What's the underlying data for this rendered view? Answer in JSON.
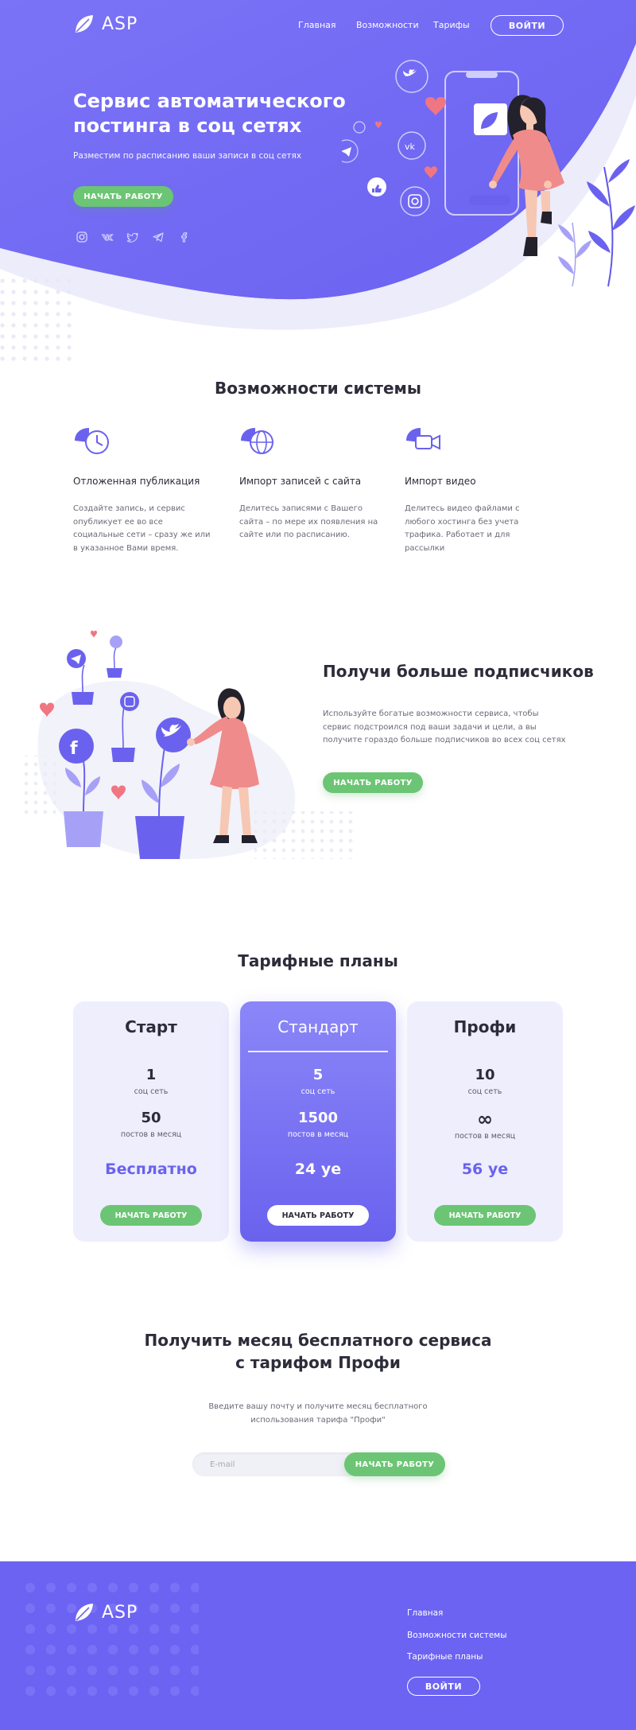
{
  "brand": {
    "name": "ASP"
  },
  "nav": {
    "items": [
      "Главная",
      "Возможности",
      "Тарифы"
    ],
    "login": "ВОЙТИ"
  },
  "hero": {
    "title": "Сервис автоматического постинга в соц сетях",
    "subtitle": "Разместим по расписанию ваши записи в соц сетях",
    "cta": "НАЧАТЬ РАБОТУ",
    "social_icons": [
      "instagram-icon",
      "vk-icon",
      "twitter-icon",
      "telegram-icon",
      "facebook-icon"
    ]
  },
  "features": {
    "title": "Возможности системы",
    "items": [
      {
        "icon": "clock-icon",
        "title": "Отложенная публикация",
        "text": "Создайте запись, и сервис опубликует ее во все социальные сети – сразу же или в указанное Вами время."
      },
      {
        "icon": "globe-icon",
        "title": "Импорт записей с сайта",
        "text": "Делитесь записями с Вашего сайта – по мере их появления на сайте или по расписанию."
      },
      {
        "icon": "video-icon",
        "title": "Импорт видео",
        "text": "Делитесь видео файлами с любого хостинга без учета трафика. Работает и для рассылки"
      }
    ]
  },
  "subscribers": {
    "title": "Получи больше подписчиков",
    "text": "Используйте богатые возможности сервиса, чтобы сервис подстроился под ваши задачи и цели, а вы получите гораздо больше подписчиков во всех соц сетях",
    "cta": "НАЧАТЬ РАБОТУ"
  },
  "pricing": {
    "title": "Тарифные планы",
    "plans": [
      {
        "name": "Старт",
        "networks": "1",
        "networks_caption": "соц сеть",
        "posts": "50",
        "posts_caption": "постов в месяц",
        "price": "Бесплатно",
        "cta": "НАЧАТЬ РАБОТУ"
      },
      {
        "name": "Стандарт",
        "networks": "5",
        "networks_caption": "соц сеть",
        "posts": "1500",
        "posts_caption": "постов в месяц",
        "price": "24 уе",
        "cta": "НАЧАТЬ РАБОТУ"
      },
      {
        "name": "Профи",
        "networks": "10",
        "networks_caption": "соц сеть",
        "posts": "∞",
        "posts_caption": "постов в месяц",
        "price": "56 уе",
        "cta": "НАЧАТЬ РАБОТУ"
      }
    ]
  },
  "trial": {
    "title_line1": "Получить месяц бесплатного сервиса",
    "title_line2": "с тарифом Профи",
    "text_line1": "Введите вашу почту и получите месяц бесплатного",
    "text_line2": "использования тарифа \"Профи\"",
    "email_placeholder": "E-mail",
    "cta": "НАЧАТЬ РАБОТУ"
  },
  "footer": {
    "brand": "ASP",
    "links": [
      "Главная",
      "Возможности системы",
      "Тарифные планы"
    ],
    "login": "ВОЙТИ"
  },
  "colors": {
    "primary": "#6c63f3",
    "green": "#6cc574",
    "pink": "#f07682",
    "light_plan": "#eeeefd"
  }
}
